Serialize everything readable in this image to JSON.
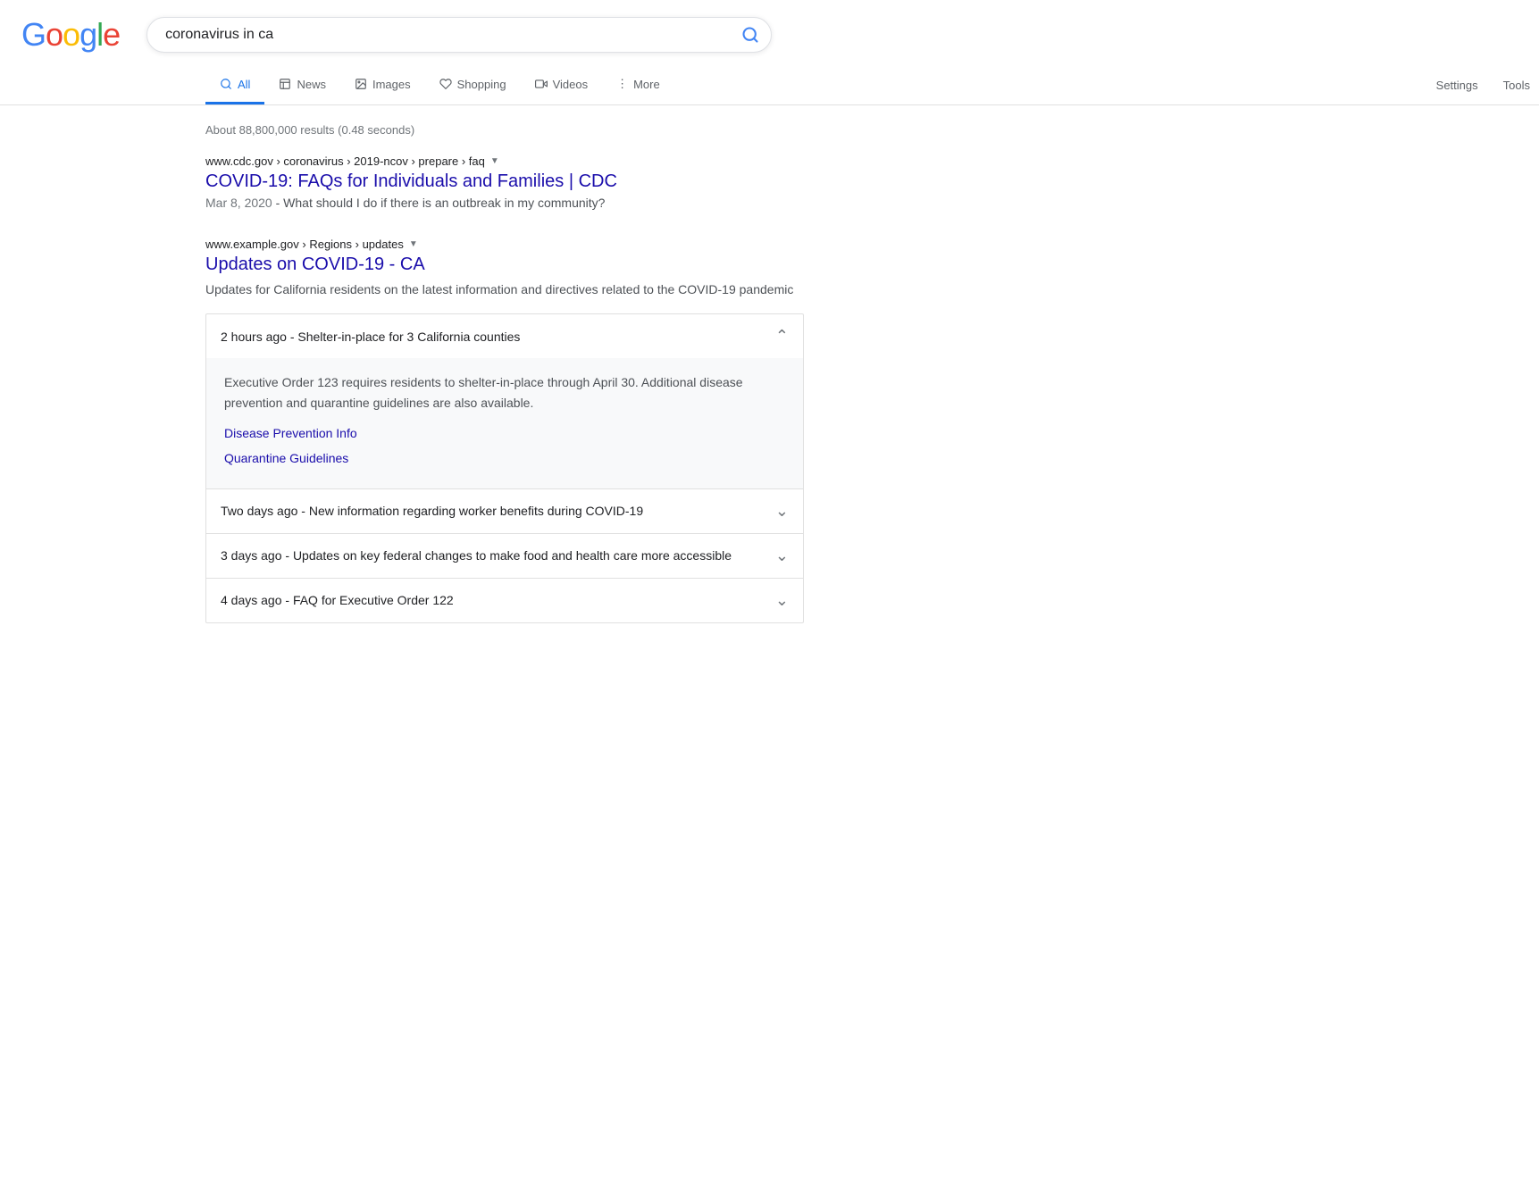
{
  "logo": {
    "letters": [
      {
        "char": "G",
        "class": "g-blue"
      },
      {
        "char": "o",
        "class": "g-red"
      },
      {
        "char": "o",
        "class": "g-yellow"
      },
      {
        "char": "g",
        "class": "g-blue"
      },
      {
        "char": "l",
        "class": "g-green"
      },
      {
        "char": "e",
        "class": "g-red"
      }
    ]
  },
  "search": {
    "query": "coronavirus in ca",
    "placeholder": "Search"
  },
  "nav": {
    "tabs": [
      {
        "id": "all",
        "label": "All",
        "active": true,
        "icon": "🔍"
      },
      {
        "id": "news",
        "label": "News",
        "active": false,
        "icon": "▦"
      },
      {
        "id": "images",
        "label": "Images",
        "active": false,
        "icon": "🖼"
      },
      {
        "id": "shopping",
        "label": "Shopping",
        "active": false,
        "icon": "◇"
      },
      {
        "id": "videos",
        "label": "Videos",
        "active": false,
        "icon": "▷"
      },
      {
        "id": "more",
        "label": "More",
        "active": false,
        "icon": "⋮"
      }
    ],
    "settings_label": "Settings",
    "tools_label": "Tools"
  },
  "results_count": "About 88,800,000 results (0.48 seconds)",
  "results": [
    {
      "id": "result-1",
      "url": "www.cdc.gov › coronavirus › 2019-ncov › prepare › faq",
      "title": "COVID-19: FAQs for Individuals and Families | CDC",
      "snippet_date": "Mar 8, 2020",
      "snippet": "What should I do if there is an outbreak in my community?"
    },
    {
      "id": "result-2",
      "url": "www.example.gov › Regions › updates",
      "title": "Updates on COVID-19 - CA",
      "description": "Updates for California residents on the latest information and directives related to the COVID-19 pandemic",
      "expandable_items": [
        {
          "id": "item-1",
          "header": "2 hours ago - Shelter-in-place for 3 California counties",
          "expanded": true,
          "content": {
            "text": "Executive Order 123 requires residents to shelter-in-place through April 30. Additional disease prevention and quarantine guidelines are also available.",
            "links": [
              {
                "label": "Disease Prevention Info",
                "href": "#"
              },
              {
                "label": "Quarantine Guidelines",
                "href": "#"
              }
            ]
          }
        },
        {
          "id": "item-2",
          "header": "Two days ago - New information regarding worker benefits during COVID-19",
          "expanded": false
        },
        {
          "id": "item-3",
          "header": "3 days ago - Updates on key federal changes to make food and health care more accessible",
          "expanded": false
        },
        {
          "id": "item-4",
          "header": "4 days ago - FAQ for Executive Order 122",
          "expanded": false
        }
      ]
    }
  ]
}
